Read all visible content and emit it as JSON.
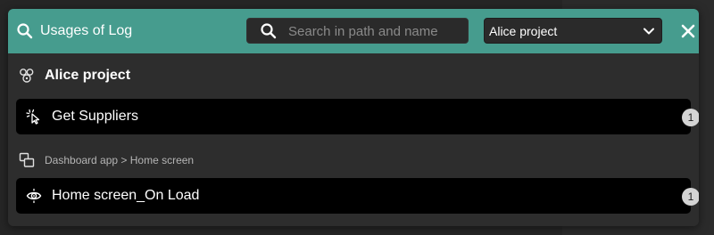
{
  "header": {
    "title": "Usages of Log",
    "search": {
      "value": "",
      "placeholder": "Search in path and name"
    },
    "project_select": {
      "selected": "Alice project"
    },
    "accent_color": "#469c8e"
  },
  "results": {
    "project": {
      "name": "Alice project",
      "icon": "project-icon"
    },
    "groups": [
      {
        "path": "",
        "items": [
          {
            "label": "Get Suppliers",
            "icon": "cursor-click-icon",
            "count": "1"
          }
        ]
      },
      {
        "path": "Dashboard app > Home screen",
        "path_icon": "screen-icon",
        "items": [
          {
            "label": "Home screen_On Load",
            "icon": "eye-icon",
            "count": "1"
          }
        ]
      }
    ]
  }
}
